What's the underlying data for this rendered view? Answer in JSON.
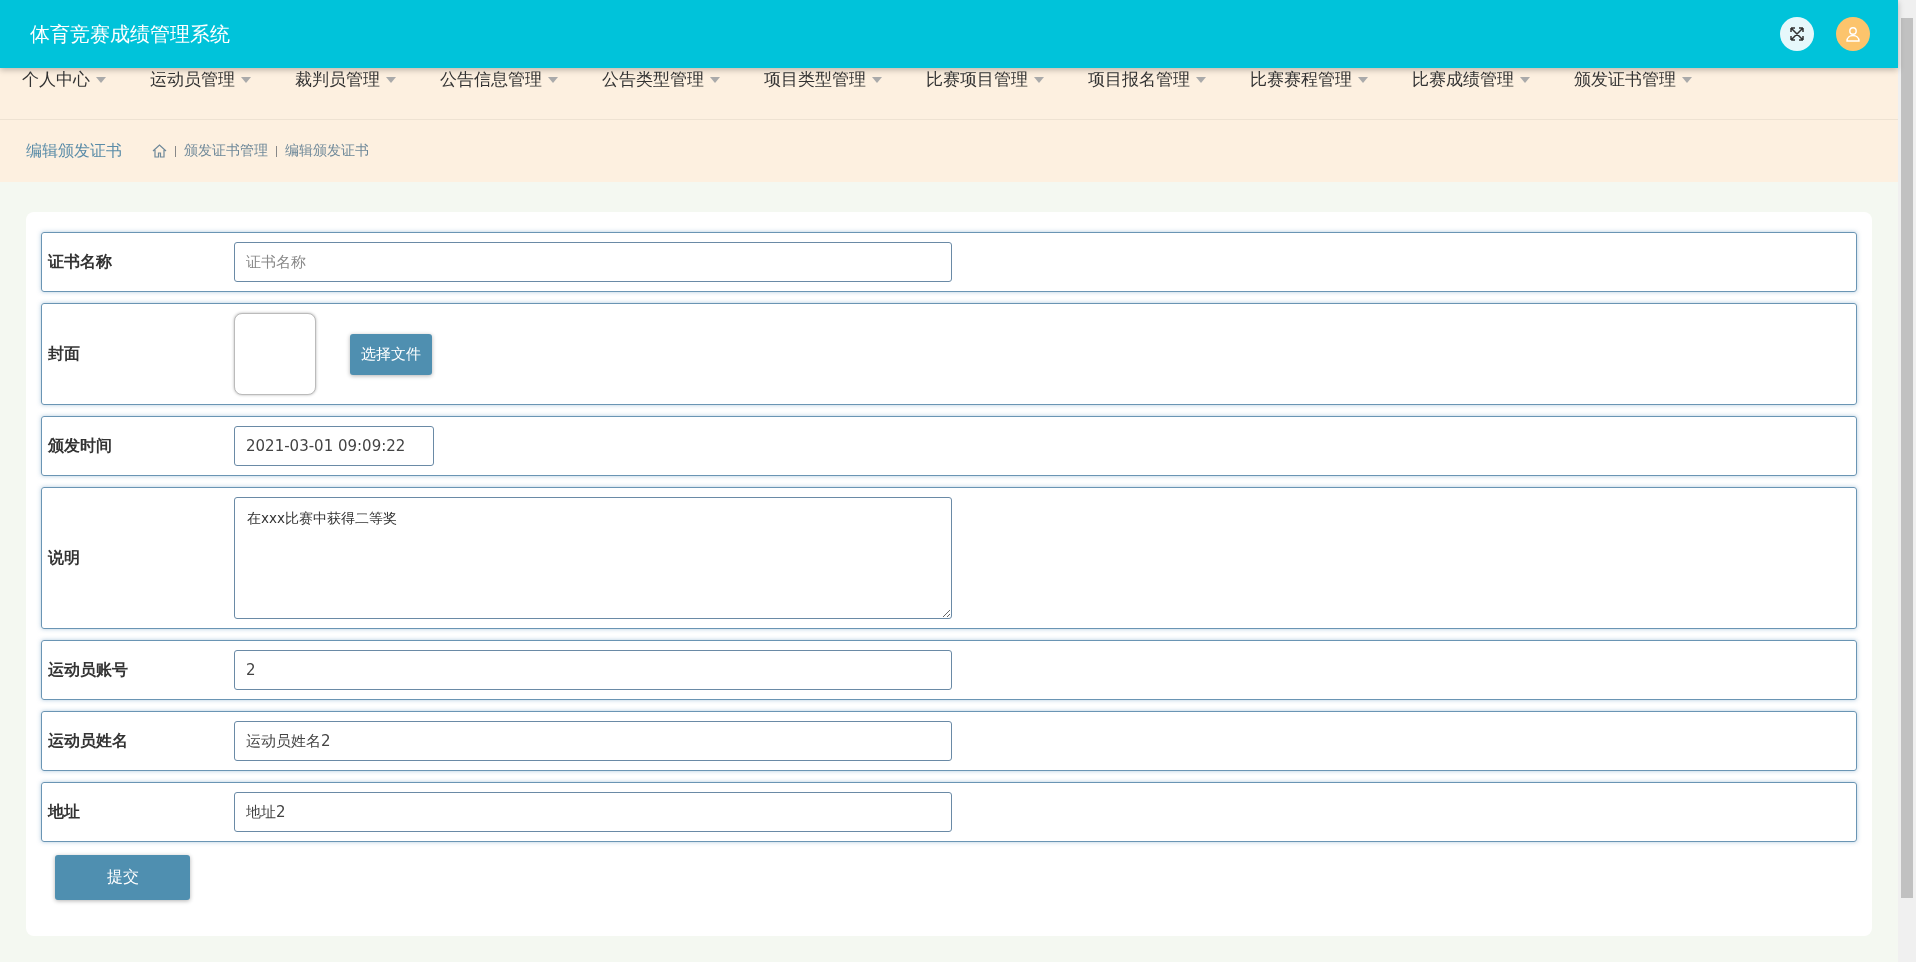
{
  "header": {
    "title": "体育竞赛成绩管理系统"
  },
  "nav": [
    {
      "label": "个人中心"
    },
    {
      "label": "运动员管理"
    },
    {
      "label": "裁判员管理"
    },
    {
      "label": "公告信息管理"
    },
    {
      "label": "公告类型管理"
    },
    {
      "label": "项目类型管理"
    },
    {
      "label": "比赛项目管理"
    },
    {
      "label": "项目报名管理"
    },
    {
      "label": "比赛赛程管理"
    },
    {
      "label": "比赛成绩管理"
    },
    {
      "label": "颁发证书管理"
    }
  ],
  "breadcrumb": {
    "title": "编辑颁发证书",
    "trail": [
      "颁发证书管理",
      "编辑颁发证书"
    ]
  },
  "form": {
    "fields": [
      {
        "kind": "text",
        "label": "证书名称",
        "placeholder": "证书名称"
      },
      {
        "kind": "image",
        "label": "封面",
        "button": "选择文件"
      },
      {
        "kind": "date",
        "label": "颁发时间",
        "value": "2021-03-01 09:09:22"
      },
      {
        "kind": "textarea",
        "label": "说明",
        "value": "在xxx比赛中获得二等奖"
      },
      {
        "kind": "text",
        "label": "运动员账号",
        "value": "2"
      },
      {
        "kind": "text",
        "label": "运动员姓名",
        "value": "运动员姓名2"
      },
      {
        "kind": "text",
        "label": "地址",
        "value": "地址2"
      }
    ],
    "submit": "提交"
  }
}
